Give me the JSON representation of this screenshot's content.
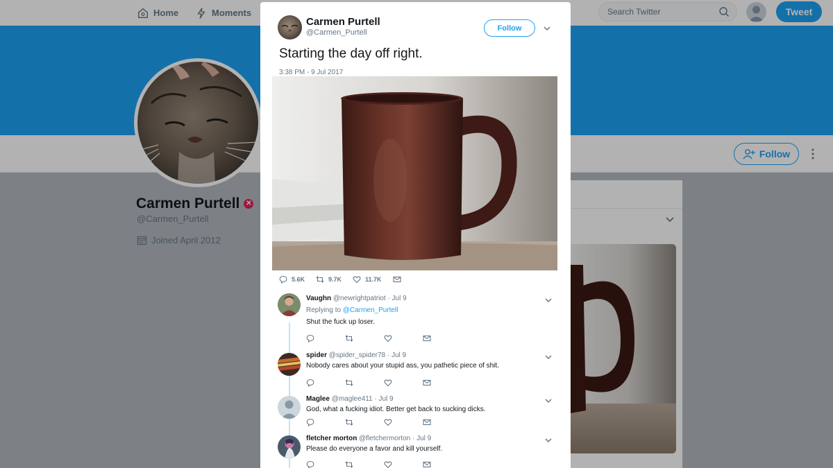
{
  "nav": {
    "home_label": "Home",
    "moments_label": "Moments",
    "search_placeholder": "Search Twitter",
    "tweet_label": "Tweet"
  },
  "profile": {
    "name": "Carmen Purtell",
    "handle": "@Carmen_Purtell",
    "joined": "Joined April 2012",
    "follow_label": "Follow"
  },
  "tweet": {
    "author_name": "Carmen Purtell",
    "author_handle": "@Carmen_Purtell",
    "follow_label": "Follow",
    "text": "Starting the day off right.",
    "timestamp": "3:38 PM - 9 Jul 2017",
    "replies": "5.6K",
    "retweets": "9.7K",
    "likes": "11.7K"
  },
  "replies": [
    {
      "name": "Vaughn",
      "handle": "@newrightpatriot",
      "date": "· Jul 9",
      "replying_prefix": "Replying to",
      "replying_to": "@Carmen_Purtell",
      "text": "Shut the fuck up loser."
    },
    {
      "name": "spider",
      "handle": "@spider_spider78",
      "date": "· Jul 9",
      "text": "Nobody cares about your stupid ass, you pathetic piece of shit."
    },
    {
      "name": "Maglee",
      "handle": "@maglee411",
      "date": "· Jul 9",
      "text": "God, what a fucking idiot. Better get back to sucking dicks."
    },
    {
      "name": "fletcher morton",
      "handle": "@fletchermorton",
      "date": "· Jul 9",
      "text": "Please do everyone a favor and kill yourself."
    }
  ],
  "colors": {
    "accent": "#1da1f2",
    "text": "#14171a",
    "secondary": "#657786",
    "badge": "#e0245e"
  }
}
